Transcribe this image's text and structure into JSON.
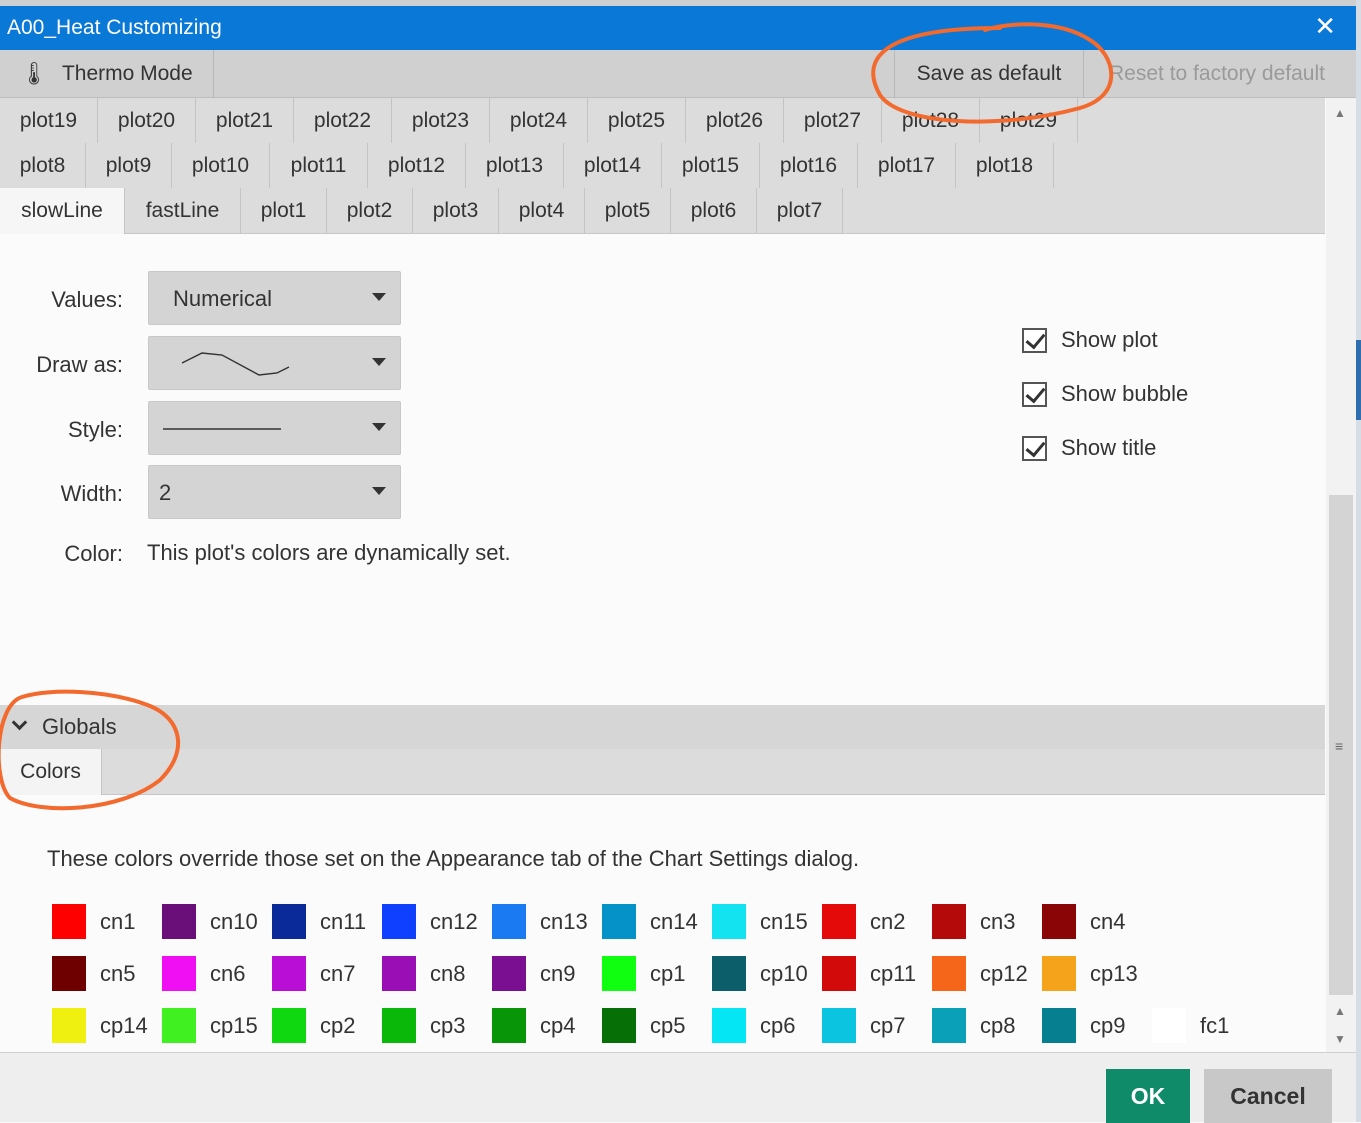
{
  "window": {
    "title": "A00_Heat Customizing",
    "close_glyph": "✕"
  },
  "toolbar": {
    "thermo_icon": "thermometer-icon",
    "thermo_label": "Thermo Mode",
    "save_label": "Save as default",
    "reset_label": "Reset to factory default"
  },
  "tabs": {
    "row1": [
      "plot19",
      "plot20",
      "plot21",
      "plot22",
      "plot23",
      "plot24",
      "plot25",
      "plot26",
      "plot27",
      "plot28",
      "plot29"
    ],
    "row2": [
      "plot8",
      "plot9",
      "plot10",
      "plot11",
      "plot12",
      "plot13",
      "plot14",
      "plot15",
      "plot16",
      "plot17",
      "plot18"
    ],
    "row3": [
      "slowLine",
      "fastLine",
      "plot1",
      "plot2",
      "plot3",
      "plot4",
      "plot5",
      "plot6",
      "plot7"
    ],
    "active": "slowLine"
  },
  "form": {
    "values_label": "Values:",
    "values_value": "Numerical",
    "drawas_label": "Draw as:",
    "drawas_icon": "line-plot-icon",
    "style_label": "Style:",
    "style_icon": "solid-line-icon",
    "width_label": "Width:",
    "width_value": "2",
    "color_label": "Color:",
    "color_text": "This plot's colors are dynamically set."
  },
  "checkboxes": {
    "show_plot": {
      "label": "Show plot",
      "checked": true
    },
    "show_bubble": {
      "label": "Show bubble",
      "checked": true
    },
    "show_title": {
      "label": "Show title",
      "checked": true
    }
  },
  "globals": {
    "label": "Globals",
    "colors_tab": "Colors",
    "note": "These colors override those set on the Appearance tab of the Chart Settings dialog.",
    "swatches": [
      [
        {
          "name": "cn1",
          "color": "#ff0000"
        },
        {
          "name": "cn10",
          "color": "#6a0f7a"
        },
        {
          "name": "cn11",
          "color": "#0a2a9a"
        },
        {
          "name": "cn12",
          "color": "#1040ff"
        },
        {
          "name": "cn13",
          "color": "#1a7af2"
        },
        {
          "name": "cn14",
          "color": "#0592c8"
        },
        {
          "name": "cn15",
          "color": "#13e3f0"
        },
        {
          "name": "cn2",
          "color": "#e40a0a"
        },
        {
          "name": "cn3",
          "color": "#b40a0a"
        },
        {
          "name": "cn4",
          "color": "#8a0505"
        }
      ],
      [
        {
          "name": "cn5",
          "color": "#6e0000"
        },
        {
          "name": "cn6",
          "color": "#f00ef2"
        },
        {
          "name": "cn7",
          "color": "#b80ed6"
        },
        {
          "name": "cn8",
          "color": "#9a0fb5"
        },
        {
          "name": "cn9",
          "color": "#7a0f92"
        },
        {
          "name": "cp1",
          "color": "#10ff10"
        },
        {
          "name": "cp10",
          "color": "#0b5e6a"
        },
        {
          "name": "cp11",
          "color": "#d20a0a"
        },
        {
          "name": "cp12",
          "color": "#f5661a"
        },
        {
          "name": "cp13",
          "color": "#f5a31a"
        }
      ],
      [
        {
          "name": "cp14",
          "color": "#f0f010"
        },
        {
          "name": "cp15",
          "color": "#40f020"
        },
        {
          "name": "cp2",
          "color": "#10d810"
        },
        {
          "name": "cp3",
          "color": "#0ab80a"
        },
        {
          "name": "cp4",
          "color": "#089508"
        },
        {
          "name": "cp5",
          "color": "#066f06"
        },
        {
          "name": "cp6",
          "color": "#05e6f5"
        },
        {
          "name": "cp7",
          "color": "#0ac4e0"
        },
        {
          "name": "cp8",
          "color": "#0aa0b8"
        },
        {
          "name": "cp9",
          "color": "#067f90"
        },
        {
          "name": "fc1",
          "color": "#ffffff"
        }
      ]
    ]
  },
  "footer": {
    "ok_label": "OK",
    "cancel_label": "Cancel"
  },
  "annotation_color": "#f26a2e"
}
